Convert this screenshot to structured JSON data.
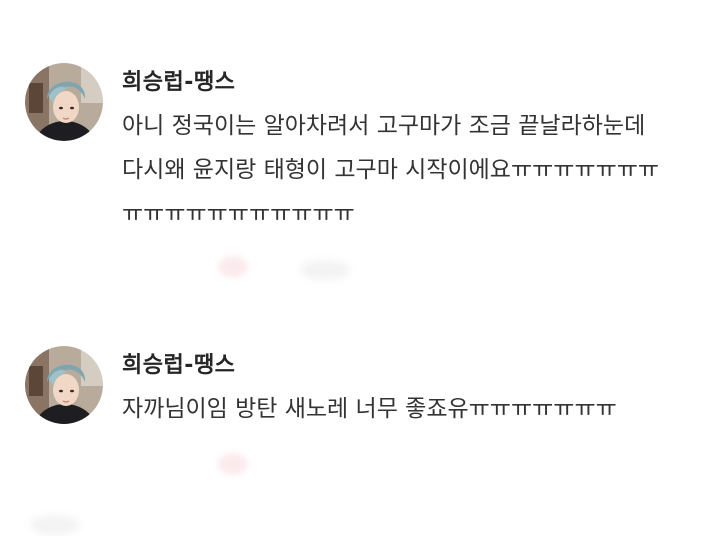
{
  "comments": [
    {
      "author": "희승럽-땡스",
      "lines": [
        "아니 정국이는 알아차려서 고구마가 조금 끝날라하눈데",
        "다시왜 윤지랑 태형이 고구마 시작이에요ㅠㅠㅠㅠㅠㅠㅠ",
        "ㅠㅠㅠㅠㅠㅠㅠㅠㅠㅠㅠ"
      ],
      "avatar_icon": "profile-photo"
    },
    {
      "author": "희승럽-땡스",
      "lines": [
        "자까님이임 방탄 새노레 너무 좋죠유ㅠㅠㅠㅠㅠㅠㅠ"
      ],
      "avatar_icon": "profile-photo"
    }
  ],
  "colors": {
    "text": "#333333",
    "author": "#262626",
    "background": "#ffffff"
  }
}
